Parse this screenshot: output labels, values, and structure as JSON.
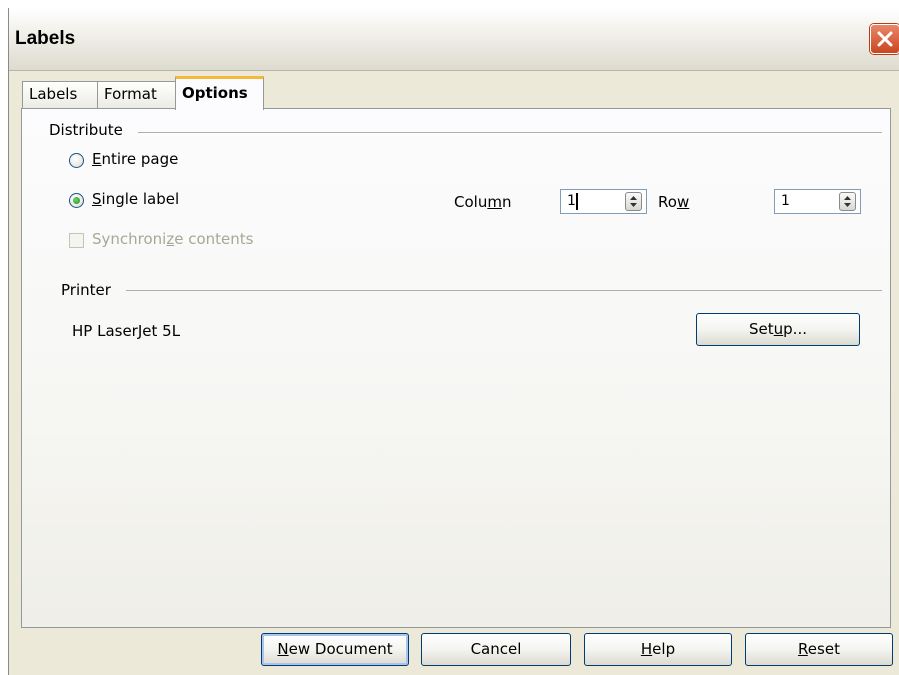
{
  "window": {
    "title": "Labels"
  },
  "tabs": [
    {
      "label": "Labels",
      "active": false
    },
    {
      "label": "Format",
      "active": false
    },
    {
      "label": "Options",
      "active": true
    }
  ],
  "distribute": {
    "heading": "Distribute",
    "entire_page": {
      "prefix": "",
      "accel": "E",
      "rest": "ntire page",
      "selected": false
    },
    "single_label": {
      "prefix": "",
      "accel": "S",
      "rest": "ingle label",
      "selected": true
    },
    "synchronize": {
      "prefix": "Synchroni",
      "accel": "z",
      "rest": "e contents",
      "checked": false,
      "enabled": false
    },
    "column": {
      "prefix": "Colu",
      "accel": "m",
      "rest": "n",
      "value": "1"
    },
    "row": {
      "prefix": "Ro",
      "accel": "w",
      "rest": "",
      "value": "1"
    }
  },
  "printer": {
    "heading": "Printer",
    "name": "HP LaserJet 5L",
    "setup": {
      "prefix": "Set",
      "accel": "u",
      "rest": "p..."
    }
  },
  "buttons": {
    "new_document": {
      "prefix": "",
      "accel": "N",
      "rest": "ew Document"
    },
    "cancel": {
      "label": "Cancel"
    },
    "help": {
      "prefix": "",
      "accel": "H",
      "rest": "elp"
    },
    "reset": {
      "prefix": "",
      "accel": "R",
      "rest": "eset"
    }
  },
  "colors": {
    "accent_tab": "#f6b73d",
    "radio_dot": "#21a121",
    "close_red": "#c9461f"
  }
}
